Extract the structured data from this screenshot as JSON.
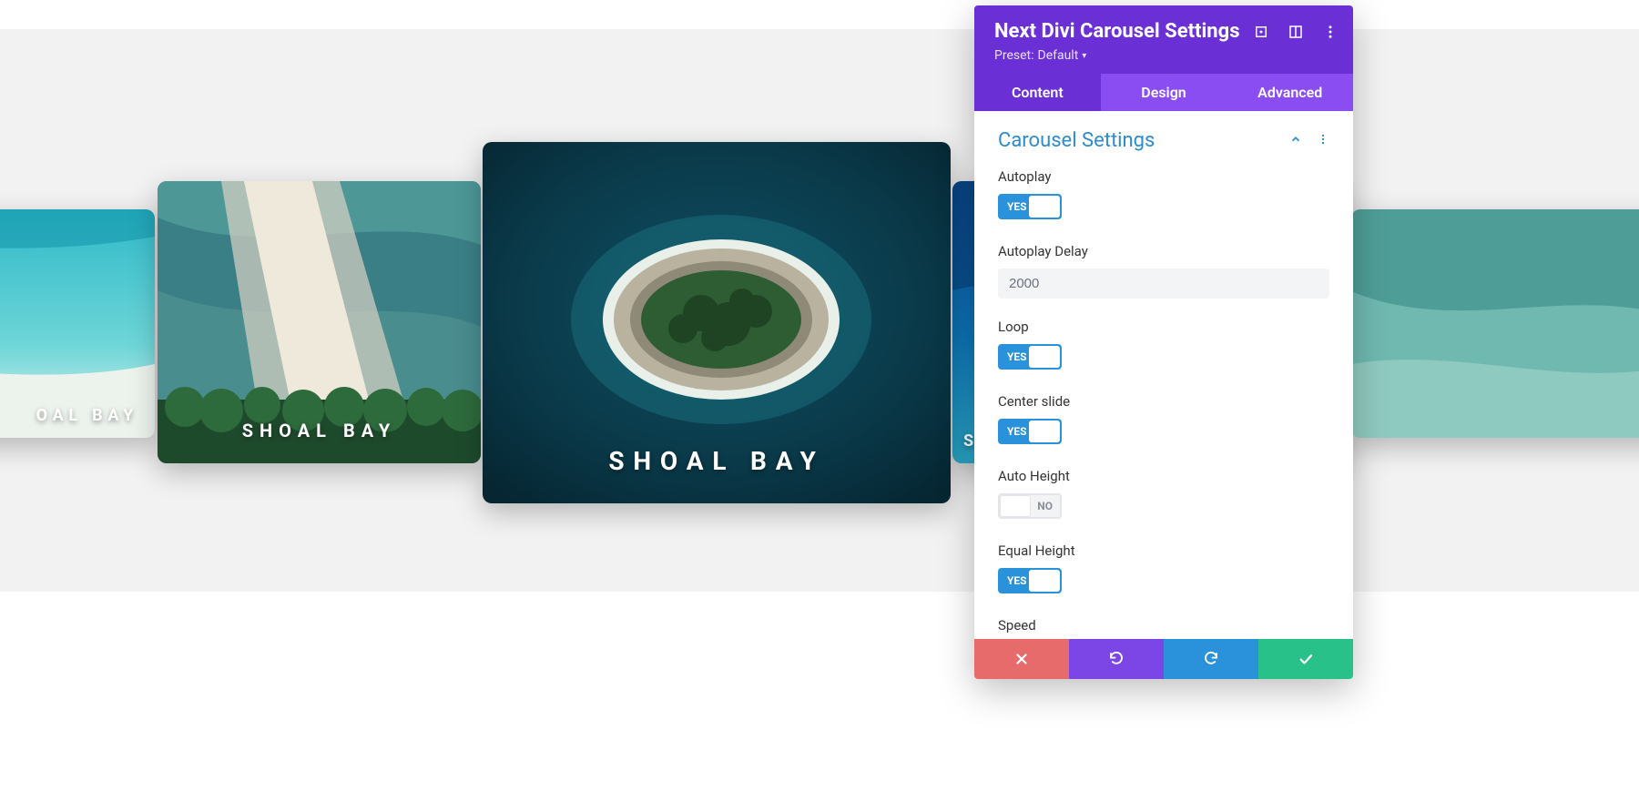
{
  "carousel": {
    "slides": [
      {
        "caption": "OAL BAY"
      },
      {
        "caption": "SHOAL BAY"
      },
      {
        "caption": "SHOAL BAY"
      },
      {
        "caption": "SH"
      },
      {
        "caption": ""
      }
    ]
  },
  "panel": {
    "title": "Next Divi Carousel Settings",
    "preset_label": "Preset:",
    "preset_value": "Default",
    "tabs": {
      "content": "Content",
      "design": "Design",
      "advanced": "Advanced"
    },
    "section_title": "Carousel Settings",
    "fields": {
      "autoplay": {
        "label": "Autoplay",
        "value": "YES"
      },
      "autoplay_delay": {
        "label": "Autoplay Delay",
        "value": "2000"
      },
      "loop": {
        "label": "Loop",
        "value": "YES"
      },
      "center_slide": {
        "label": "Center slide",
        "value": "YES"
      },
      "auto_height": {
        "label": "Auto Height",
        "value": "NO"
      },
      "equal_height": {
        "label": "Equal Height",
        "value": "YES"
      },
      "speed": {
        "label": "Speed"
      }
    }
  }
}
